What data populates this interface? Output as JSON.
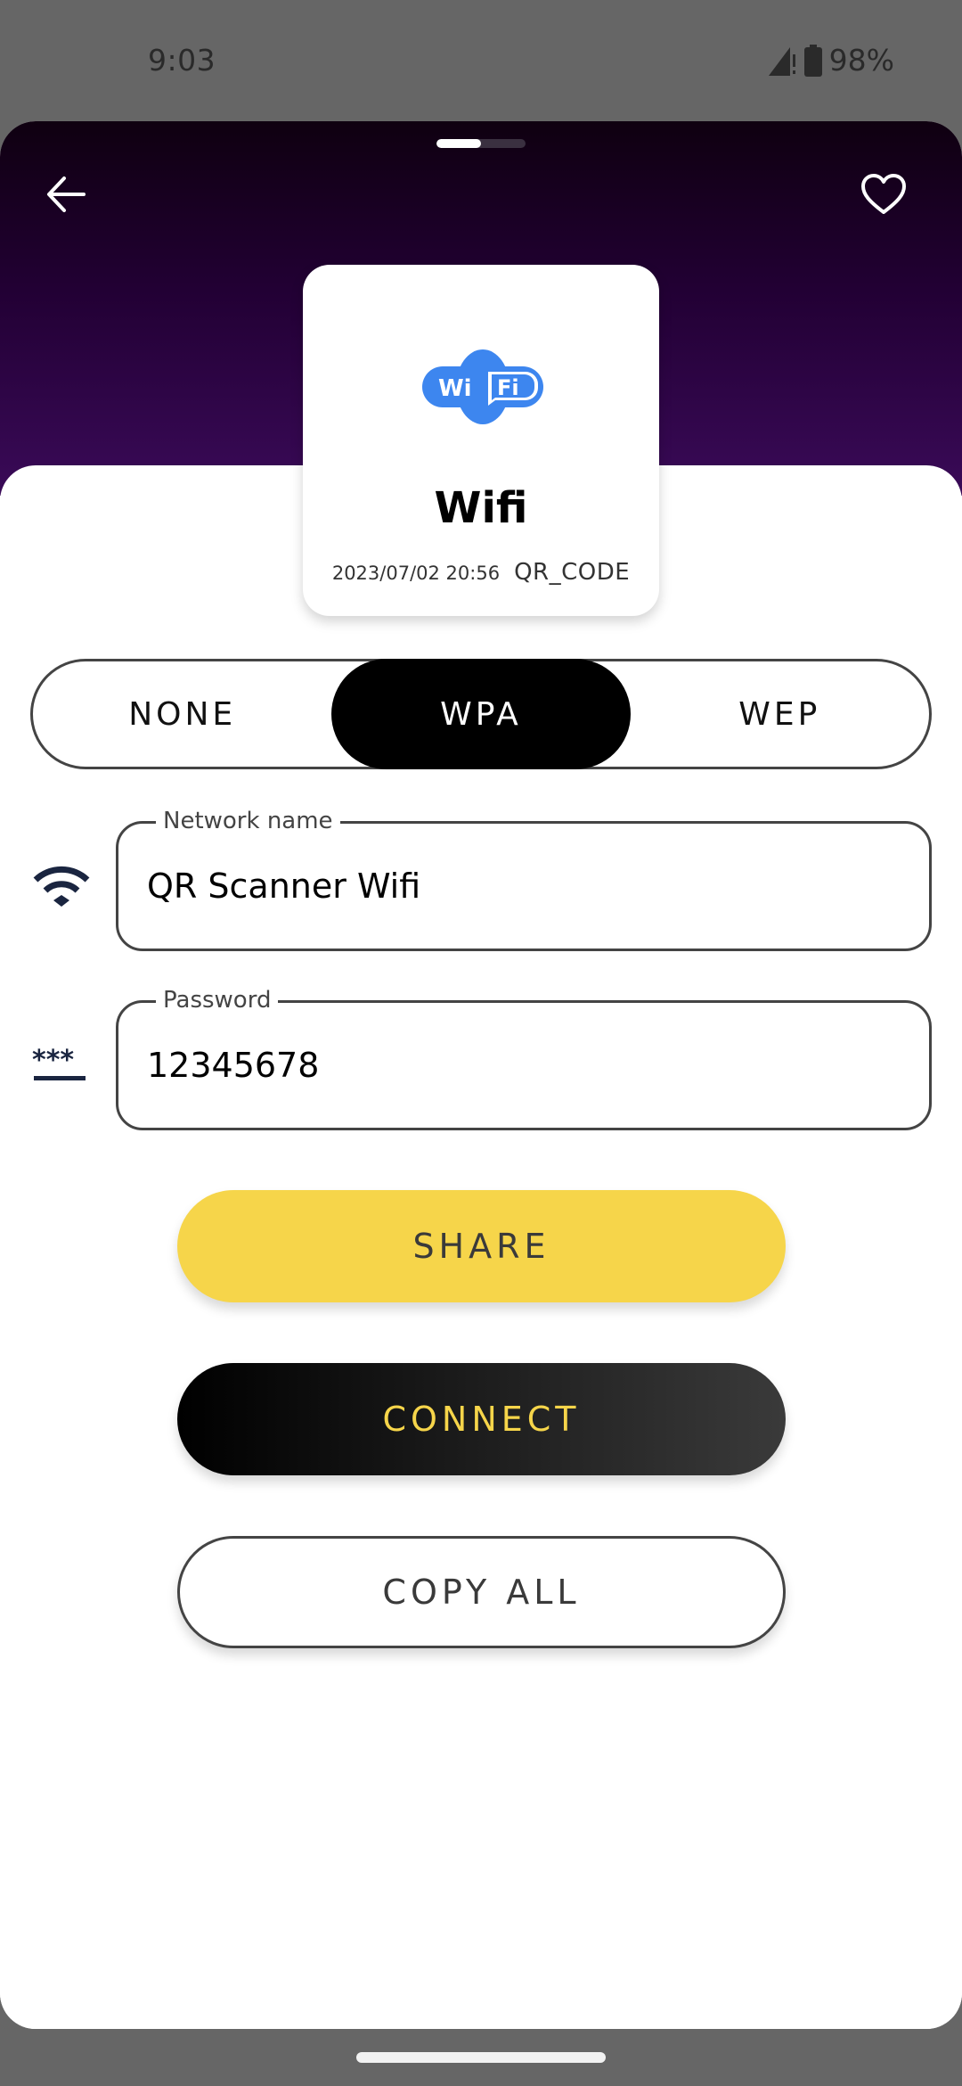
{
  "status_bar": {
    "time": "9:03",
    "battery": "98%",
    "icons": [
      "signal-alert-icon",
      "battery-icon"
    ]
  },
  "header": {
    "back_icon": "arrow-left-icon",
    "favorite_icon": "heart-outline-icon",
    "pager_progress": 0.5
  },
  "card": {
    "logo_text_left": "Wi",
    "logo_text_right": "Fi",
    "title": "Wifi",
    "timestamp": "2023/07/02 20:56",
    "code_type": "QR_CODE"
  },
  "security": {
    "options": [
      "NONE",
      "WPA",
      "WEP"
    ],
    "selected": "WPA"
  },
  "fields": {
    "network": {
      "label": "Network name",
      "value": "QR Scanner Wifi",
      "icon": "wifi-icon"
    },
    "password": {
      "label": "Password",
      "value": "12345678",
      "icon": "password-icon"
    }
  },
  "actions": {
    "share": "SHARE",
    "connect": "CONNECT",
    "copy_all": "COPY ALL"
  },
  "colors": {
    "accent_yellow": "#f6d54a",
    "header_purple": "#3a0a58",
    "wifi_blue": "#3d86ef",
    "icon_navy": "#1a2540"
  }
}
